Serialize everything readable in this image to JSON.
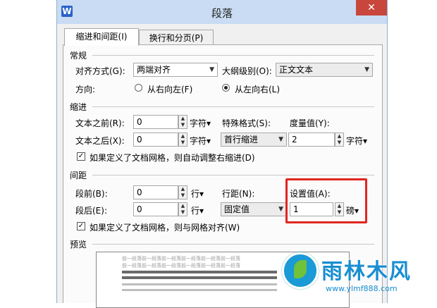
{
  "dialog": {
    "title": "段落",
    "app_icon": "W",
    "close": "✕"
  },
  "tabs": [
    {
      "label": "缩进和间距(I)"
    },
    {
      "label": "换行和分页(P)"
    }
  ],
  "general": {
    "title": "常规",
    "alignment_label": "对齐方式(G):",
    "alignment_value": "两端对齐",
    "outline_label": "大纲级别(O):",
    "outline_value": "正文文本",
    "direction_label": "方向:",
    "rtl_label": "从右向左(F)",
    "ltr_label": "从左向右(L)"
  },
  "indent": {
    "title": "缩进",
    "before_label": "文本之前(R):",
    "before_value": "0",
    "before_unit": "字符▾",
    "after_label": "文本之后(X):",
    "after_value": "0",
    "after_unit": "字符▾",
    "special_label": "特殊格式(S):",
    "special_value": "首行缩进",
    "measure_label": "度量值(Y):",
    "measure_value": "2",
    "measure_unit": "字符▾",
    "grid_check_label": "如果定义了文档网格，则自动调整右缩进(D)"
  },
  "spacing": {
    "title": "间距",
    "before_label": "段前(B):",
    "before_value": "0",
    "before_unit": "行▾",
    "after_label": "段后(E):",
    "after_value": "0",
    "after_unit": "行▾",
    "line_label": "行距(N):",
    "line_value": "固定值",
    "setting_label": "设置值(A):",
    "setting_value": "1",
    "setting_unit": "磅▾",
    "grid_check_label": "如果定义了文档网格，则与网格对齐(W)"
  },
  "preview": {
    "title": "预览",
    "sample_text": "前一段落前一段落前一段落前一段落前一段落前一段落"
  },
  "watermark": {
    "brand": "雨林木风",
    "url": "www.ylmf888.com"
  },
  "icons": {
    "spin_up": "▲",
    "spin_down": "▼",
    "dropdown": "▼",
    "check": "✓"
  }
}
